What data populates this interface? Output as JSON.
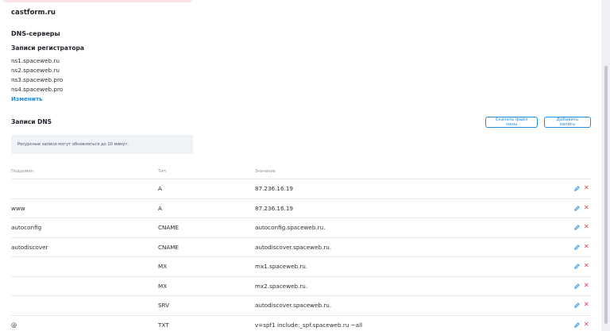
{
  "domain_name": "castform.ru",
  "dns_servers_title": "DNS-серверы",
  "registrar_title": "Записи регистратора",
  "nameservers": [
    "ns1.spaceweb.ru",
    "ns2.spaceweb.ru",
    "ns3.spaceweb.pro",
    "ns4.spaceweb.pro"
  ],
  "edit_link": "Изменить",
  "records_title": "Записи DNS",
  "buttons": {
    "download_zone": "Скачать файл зоны",
    "add_record": "Добавить запись"
  },
  "notice": "Ресурсные записи могут обновляться до 10 минут.",
  "table": {
    "headers": {
      "subdomain": "Поддомен",
      "type": "Тип",
      "value": "Значение"
    },
    "rows": [
      {
        "sub": "",
        "type": "A",
        "value": "87.236.16.19"
      },
      {
        "sub": "www",
        "type": "A",
        "value": "87.236.16.19"
      },
      {
        "sub": "autoconfig",
        "type": "CNAME",
        "value": "autoconfig.spaceweb.ru."
      },
      {
        "sub": "autodiscover",
        "type": "CNAME",
        "value": "autodiscover.spaceweb.ru."
      },
      {
        "sub": "",
        "type": "MX",
        "value": "mx1.spaceweb.ru."
      },
      {
        "sub": "",
        "type": "MX",
        "value": "mx2.spaceweb.ru."
      },
      {
        "sub": "",
        "type": "SRV",
        "value": "autodiscover.spaceweb.ru."
      },
      {
        "sub": "@",
        "type": "TXT",
        "value": "v=spf1 include:_spf.spaceweb.ru ~all"
      }
    ]
  },
  "icons": {
    "edit": "pencil-icon",
    "delete": "close-icon"
  },
  "colors": {
    "accent": "#1f8ce0",
    "danger": "#e0364a"
  }
}
